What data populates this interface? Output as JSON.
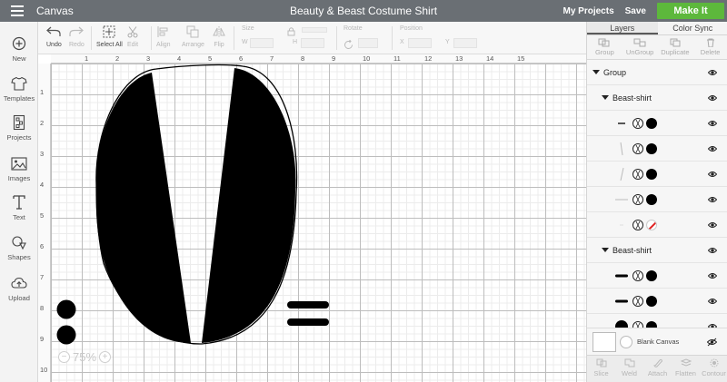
{
  "topbar": {
    "app_title": "Canvas",
    "doc_title": "Beauty & Beast Costume Shirt",
    "my_projects": "My Projects",
    "save": "Save",
    "make_it": "Make It",
    "make_it_color": "#5db83c"
  },
  "sidebar": {
    "items": [
      {
        "label": "New",
        "icon": "plus-circle-icon"
      },
      {
        "label": "Templates",
        "icon": "shirt-icon"
      },
      {
        "label": "Projects",
        "icon": "projects-icon"
      },
      {
        "label": "Images",
        "icon": "image-icon"
      },
      {
        "label": "Text",
        "icon": "text-icon"
      },
      {
        "label": "Shapes",
        "icon": "shapes-icon"
      },
      {
        "label": "Upload",
        "icon": "upload-cloud-icon"
      }
    ]
  },
  "toolbar": {
    "undo": "Undo",
    "redo": "Redo",
    "select_all": "Select All",
    "edit": "Edit",
    "align": "Align",
    "arrange": "Arrange",
    "flip": "Flip",
    "size_label": "Size",
    "w_label": "W",
    "h_label": "H",
    "rotate_label": "Rotate",
    "position_label": "Position",
    "x_label": "X",
    "y_label": "Y"
  },
  "canvas": {
    "ruler_top": [
      "1",
      "2",
      "3",
      "4",
      "5",
      "6",
      "7",
      "8",
      "9",
      "10",
      "11",
      "12",
      "13",
      "14",
      "15"
    ],
    "ruler_left": [
      "1",
      "2",
      "3",
      "4",
      "5",
      "6",
      "7",
      "8",
      "9",
      "10"
    ],
    "zoom": "75%",
    "zoom_out": "−",
    "zoom_in": "+"
  },
  "panel": {
    "tabs": [
      "Layers",
      "Color Sync"
    ],
    "actions": [
      "Group",
      "UnGroup",
      "Duplicate",
      "Delete"
    ],
    "group_label": "Group",
    "beast_shirt_1": "Beast-shirt",
    "beast_shirt_2": "Beast-shirt",
    "blank_canvas": "Blank Canvas",
    "bottom_actions": [
      "Slice",
      "Weld",
      "Attach",
      "Flatten",
      "Contour"
    ]
  }
}
